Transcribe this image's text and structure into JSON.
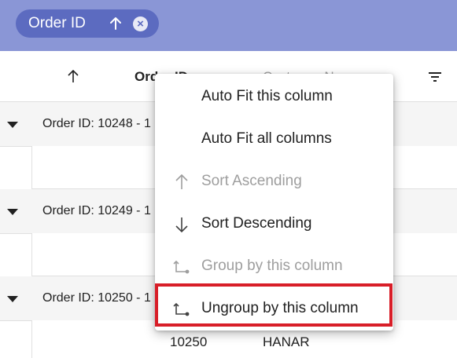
{
  "group_bar": {
    "chip": {
      "label": "Order ID",
      "sort_icon": "arrow-up-icon",
      "remove_icon": "close-circle-icon"
    }
  },
  "header": {
    "sort_icon": "arrow-up-icon",
    "columns": [
      {
        "label": "Order ID"
      },
      {
        "label": "Customer Name"
      }
    ],
    "filter_icon": "filter-icon"
  },
  "groups": [
    {
      "caption": "Order ID: 10248 - 1"
    },
    {
      "caption": "Order ID: 10249 - 1"
    },
    {
      "caption": "Order ID: 10250 - 1"
    }
  ],
  "visible_row": {
    "order_id": "10250",
    "customer": "HANAR"
  },
  "context_menu": {
    "items": [
      {
        "label": "Auto Fit this column",
        "icon": "",
        "disabled": false
      },
      {
        "label": "Auto Fit all columns",
        "icon": "",
        "disabled": false
      },
      {
        "label": "Sort Ascending",
        "icon": "arrow-up-icon",
        "disabled": true
      },
      {
        "label": "Sort Descending",
        "icon": "arrow-down-icon",
        "disabled": false
      },
      {
        "label": "Group by this column",
        "icon": "group-icon",
        "disabled": true
      },
      {
        "label": "Ungroup by this column",
        "icon": "ungroup-icon",
        "disabled": false
      }
    ]
  },
  "colors": {
    "group_bar": "#8a96d6",
    "chip": "#5c6bc0",
    "highlight": "#d81e28"
  }
}
